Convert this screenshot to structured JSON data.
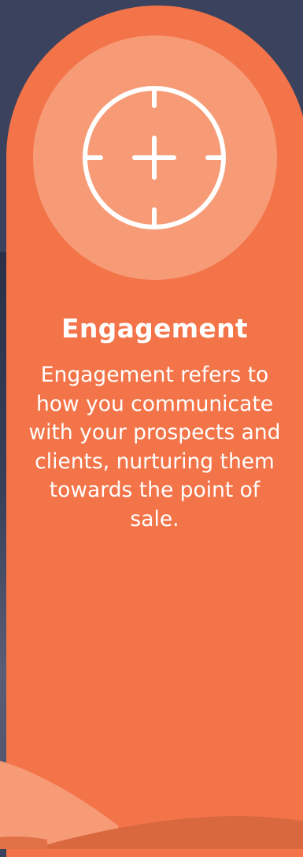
{
  "card": {
    "title": "Engagement",
    "description": "Engagement refers to how you communicate with your prospects and clients, nurturing them towards the point of sale.",
    "icon": "crosshair-plus-icon"
  },
  "colors": {
    "background": "#3a425e",
    "card": "#f37449",
    "icon_circle": "#f79b77",
    "text": "#ffffff"
  }
}
